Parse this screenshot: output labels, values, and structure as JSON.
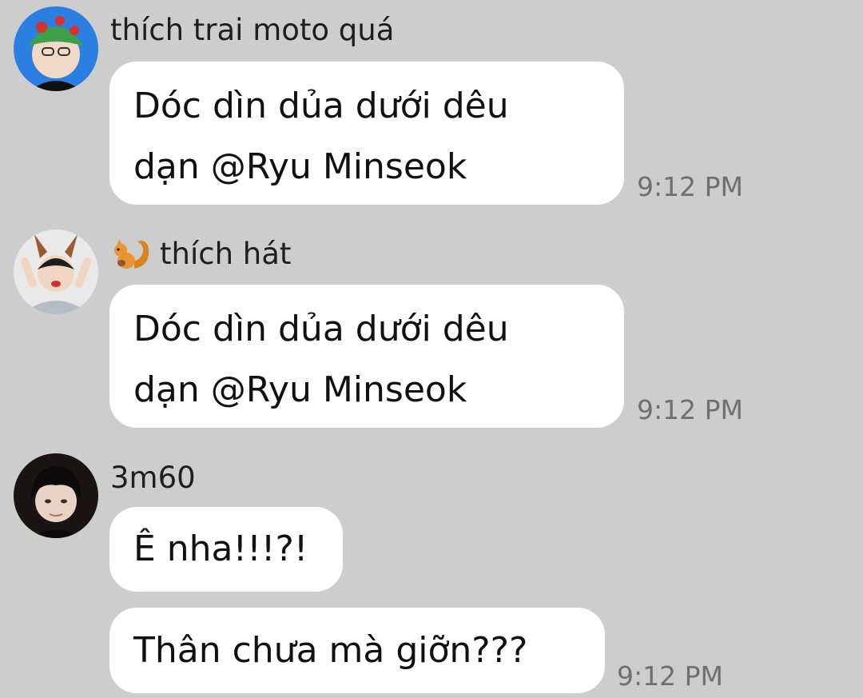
{
  "messages": [
    {
      "sender": "thích trai moto quá",
      "avatar_icon": "avatar-green-hat",
      "bubbles": [
        "Dóc dìn dủa dưới dêu\ndạn @Ryu Minseok"
      ],
      "time": "9:12 PM"
    },
    {
      "sender": "thích hát",
      "sender_badge_icon": "squirrel-icon",
      "avatar_icon": "avatar-bunny-ears",
      "bubbles": [
        "Dóc dìn dủa dưới dêu\ndạn @Ryu Minseok"
      ],
      "time": "9:12 PM"
    },
    {
      "sender": "3m60",
      "avatar_icon": "avatar-dark-hair",
      "bubbles": [
        "Ê nha!!!?!",
        "Thân chưa mà giỡn???"
      ],
      "time": "9:12 PM"
    }
  ],
  "colors": {
    "background": "#cdcdcd",
    "bubble": "#ffffff",
    "timestamp": "#6f6f6f"
  }
}
